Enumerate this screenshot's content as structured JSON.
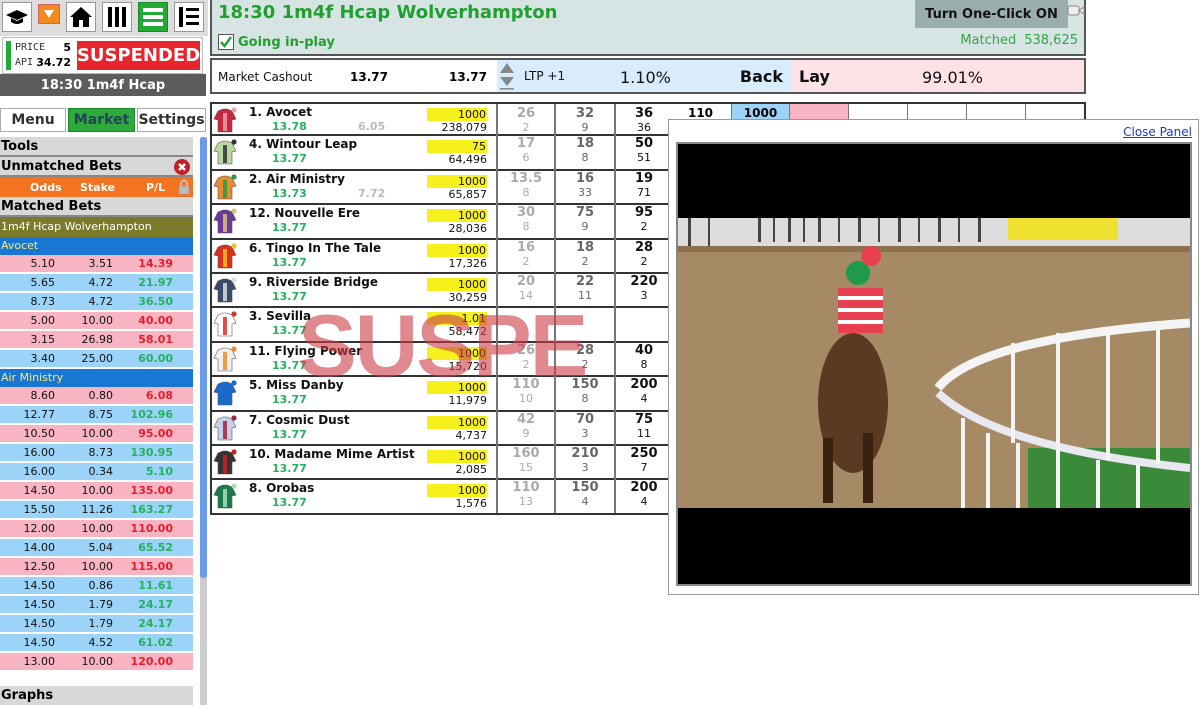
{
  "toolbar": {
    "icons": [
      "mortarboard-icon",
      "dropdown-arrow-icon",
      "home-icon",
      "columns-icon",
      "list-icon",
      "ladder-icon"
    ]
  },
  "status": {
    "price_label": "PRICE",
    "price_value": "5",
    "api_label": "API",
    "api_value": "34.72",
    "state": "SUSPENDED"
  },
  "race_label": "18:30 1m4f Hcap",
  "tabs": [
    {
      "label": "Menu",
      "active": false
    },
    {
      "label": "Market",
      "active": true
    },
    {
      "label": "Settings",
      "active": false
    }
  ],
  "panels": {
    "tools": "Tools",
    "unmatched": "Unmatched Bets",
    "col_odds": "Odds",
    "col_stake": "Stake",
    "col_pl": "P/L",
    "matched": "Matched Bets",
    "graphs": "Graphs"
  },
  "matched_bets": {
    "market": "1m4f Hcap Wolverhampton",
    "groups": [
      {
        "runner": "Avocet",
        "bets": [
          {
            "type": "lay",
            "odds": "5.10",
            "stake": "3.51",
            "pl": "14.39",
            "sign": "neg"
          },
          {
            "type": "back",
            "odds": "5.65",
            "stake": "4.72",
            "pl": "21.97",
            "sign": "pos"
          },
          {
            "type": "back",
            "odds": "8.73",
            "stake": "4.72",
            "pl": "36.50",
            "sign": "pos"
          },
          {
            "type": "lay",
            "odds": "5.00",
            "stake": "10.00",
            "pl": "40.00",
            "sign": "neg"
          },
          {
            "type": "lay",
            "odds": "3.15",
            "stake": "26.98",
            "pl": "58.01",
            "sign": "neg"
          },
          {
            "type": "back",
            "odds": "3.40",
            "stake": "25.00",
            "pl": "60.00",
            "sign": "pos"
          }
        ]
      },
      {
        "runner": "Air Ministry",
        "bets": [
          {
            "type": "lay",
            "odds": "8.60",
            "stake": "0.80",
            "pl": "6.08",
            "sign": "neg"
          },
          {
            "type": "back",
            "odds": "12.77",
            "stake": "8.75",
            "pl": "102.96",
            "sign": "pos"
          },
          {
            "type": "lay",
            "odds": "10.50",
            "stake": "10.00",
            "pl": "95.00",
            "sign": "neg"
          },
          {
            "type": "back",
            "odds": "16.00",
            "stake": "8.73",
            "pl": "130.95",
            "sign": "pos"
          },
          {
            "type": "back",
            "odds": "16.00",
            "stake": "0.34",
            "pl": "5.10",
            "sign": "pos"
          },
          {
            "type": "lay",
            "odds": "14.50",
            "stake": "10.00",
            "pl": "135.00",
            "sign": "neg"
          },
          {
            "type": "back",
            "odds": "15.50",
            "stake": "11.26",
            "pl": "163.27",
            "sign": "pos"
          },
          {
            "type": "lay",
            "odds": "12.00",
            "stake": "10.00",
            "pl": "110.00",
            "sign": "neg"
          },
          {
            "type": "back",
            "odds": "14.00",
            "stake": "5.04",
            "pl": "65.52",
            "sign": "pos"
          },
          {
            "type": "lay",
            "odds": "12.50",
            "stake": "10.00",
            "pl": "115.00",
            "sign": "neg"
          },
          {
            "type": "back",
            "odds": "14.50",
            "stake": "0.86",
            "pl": "11.61",
            "sign": "pos"
          },
          {
            "type": "back",
            "odds": "14.50",
            "stake": "1.79",
            "pl": "24.17",
            "sign": "pos"
          },
          {
            "type": "back",
            "odds": "14.50",
            "stake": "1.79",
            "pl": "24.17",
            "sign": "pos"
          },
          {
            "type": "back",
            "odds": "14.50",
            "stake": "4.52",
            "pl": "61.02",
            "sign": "pos"
          },
          {
            "type": "lay",
            "odds": "13.00",
            "stake": "10.00",
            "pl": "120.00",
            "sign": "neg"
          }
        ]
      }
    ]
  },
  "header": {
    "title": "18:30 1m4f Hcap Wolverhampton",
    "going_inplay": "Going in-play",
    "going_inplay_checked": true,
    "one_click": "Turn One-Click ON",
    "matched_label": "Matched",
    "matched_value": "538,625"
  },
  "cashout": {
    "label": "Market Cashout",
    "value1": "13.77",
    "value2": "13.77",
    "ltp": "LTP +1",
    "back_pct": "1.10%",
    "back_label": "Back",
    "lay_label": "Lay",
    "lay_pct": "99.01%"
  },
  "runners": [
    {
      "name": "1. Avocet",
      "pl": "13.78",
      "pl2": "6.05",
      "vol_top": "1000",
      "vol": "238,079",
      "b3": [
        "26",
        "2"
      ],
      "b2": [
        "32",
        "9"
      ],
      "b1": [
        "36",
        "36"
      ],
      "silk": [
        "#c8283c",
        "#e8a0b0"
      ]
    },
    {
      "name": "4. Wintour Leap",
      "pl": "13.77",
      "pl2": "",
      "vol_top": "75",
      "vol": "64,496",
      "b3": [
        "17",
        "6"
      ],
      "b2": [
        "18",
        "8"
      ],
      "b1": [
        "50",
        "51"
      ],
      "silk": [
        "#b8d8a0",
        "#333"
      ]
    },
    {
      "name": "2. Air Ministry",
      "pl": "13.73",
      "pl2": "7.72",
      "vol_top": "1000",
      "vol": "65,857",
      "b3": [
        "13.5",
        "8"
      ],
      "b2": [
        "16",
        "33"
      ],
      "b1": [
        "19",
        "71"
      ],
      "silk": [
        "#e88a30",
        "#2a9a40"
      ]
    },
    {
      "name": "12. Nouvelle Ere",
      "pl": "13.77",
      "pl2": "",
      "vol_top": "1000",
      "vol": "28,036",
      "b3": [
        "30",
        "8"
      ],
      "b2": [
        "75",
        "9"
      ],
      "b1": [
        "95",
        "2"
      ],
      "silk": [
        "#6a3a9a",
        "#d8c070"
      ]
    },
    {
      "name": "6. Tingo In The Tale",
      "pl": "13.77",
      "pl2": "",
      "vol_top": "1000",
      "vol": "17,326",
      "b3": [
        "16",
        "2"
      ],
      "b2": [
        "18",
        "2"
      ],
      "b1": [
        "28",
        "2"
      ],
      "silk": [
        "#d83020",
        "#f0c020"
      ]
    },
    {
      "name": "9. Riverside Bridge",
      "pl": "13.77",
      "pl2": "",
      "vol_top": "1000",
      "vol": "30,259",
      "b3": [
        "20",
        "14"
      ],
      "b2": [
        "22",
        "11"
      ],
      "b1": [
        "220",
        "3"
      ],
      "silk": [
        "#3a4a6a",
        "#ddd"
      ]
    },
    {
      "name": "3. Sevilla",
      "pl": "13.77",
      "pl2": "",
      "vol_top": "1.01",
      "vol": "58,472",
      "b3": [
        "",
        ""
      ],
      "b2": [
        "",
        ""
      ],
      "b1": [
        "",
        ""
      ],
      "silk": [
        "#fff",
        "#d83030"
      ]
    },
    {
      "name": "11. Flying Power",
      "pl": "13.77",
      "pl2": "",
      "vol_top": "1000",
      "vol": "15,720",
      "b3": [
        "26",
        "2"
      ],
      "b2": [
        "28",
        "2"
      ],
      "b1": [
        "40",
        "8"
      ],
      "silk": [
        "#f0f0f0",
        "#e89020"
      ]
    },
    {
      "name": "5. Miss Danby",
      "pl": "13.77",
      "pl2": "",
      "vol_top": "1000",
      "vol": "11,979",
      "b3": [
        "110",
        "10"
      ],
      "b2": [
        "150",
        "8"
      ],
      "b1": [
        "200",
        "4"
      ],
      "silk": [
        "#1a6ac8",
        "#1a6ac8"
      ]
    },
    {
      "name": "7. Cosmic Dust",
      "pl": "13.77",
      "pl2": "",
      "vol_top": "1000",
      "vol": "4,737",
      "b3": [
        "42",
        "9"
      ],
      "b2": [
        "70",
        "3"
      ],
      "b1": [
        "75",
        "11"
      ],
      "silk": [
        "#c8d0e8",
        "#a02040"
      ]
    },
    {
      "name": "10. Madame Mime Artist",
      "pl": "13.77",
      "pl2": "",
      "vol_top": "1000",
      "vol": "2,085",
      "b3": [
        "160",
        "15"
      ],
      "b2": [
        "210",
        "3"
      ],
      "b1": [
        "250",
        "7"
      ],
      "silk": [
        "#333",
        "#d02020"
      ]
    },
    {
      "name": "8. Orobas",
      "pl": "13.77",
      "pl2": "",
      "vol_top": "1000",
      "vol": "1,576",
      "b3": [
        "110",
        "13"
      ],
      "b2": [
        "150",
        "4"
      ],
      "b1": [
        "200",
        "4"
      ],
      "silk": [
        "#1a7a4a",
        "#aaddbb"
      ]
    }
  ],
  "first_row_extra": {
    "lay_price": "110",
    "lay_stake": "1000"
  },
  "watermark": "SUSPE",
  "video_panel": {
    "close_label": "Close Panel"
  }
}
